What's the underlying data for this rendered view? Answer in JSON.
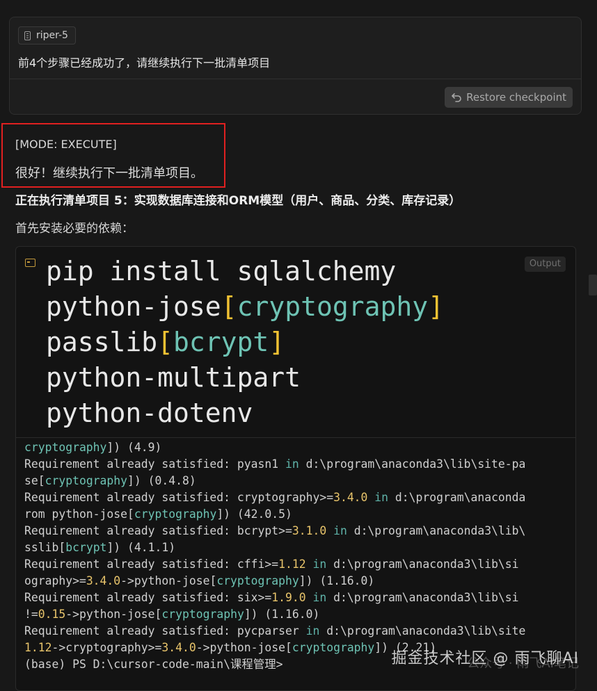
{
  "user_card": {
    "agent_name": "riper-5",
    "message": "前4个步骤已经成功了，请继续执行下一批清单项目",
    "restore_label": "Restore checkpoint"
  },
  "response": {
    "mode_line": "[MODE: EXECUTE]",
    "intro": "很好！继续执行下一批清单项目。",
    "heading": "正在执行清单项目 5：实现数据库连接和ORM模型（用户、商品、分类、库存记录）",
    "deps_label": "首先安装必要的依赖："
  },
  "terminal": {
    "output_badge": "Output",
    "command": {
      "l1": "pip install sqlalchemy",
      "l2_name": "python-jose",
      "l2_open": "[",
      "l2_extra": "cryptography",
      "l2_close": "]",
      "l3_name": "passlib",
      "l3_open": "[",
      "l3_extra": "bcrypt",
      "l3_close": "]",
      "l4": "python-multipart",
      "l5": "python-dotenv"
    },
    "output": {
      "l1_pkg": "cryptography",
      "l1_a": "]) (4.9)",
      "req": "Requirement already satisfied:",
      "in": "in",
      "l2_b": " pyasn1 ",
      "l2_c": " d:\\program\\anaconda3\\lib\\site-pa",
      "l3_a": "se[",
      "l3_pkg": "cryptography",
      "l3_b": "]) (0.4.8)",
      "l4_b": " cryptography>=",
      "l4_n": "3.4.0",
      "l4_c": " d:\\program\\anaconda",
      "l5_a": "rom python-jose[",
      "l5_pkg": "cryptography",
      "l5_b": "]) (42.0.5)",
      "l6_b": " bcrypt>=",
      "l6_n": "3.1.0",
      "l6_c": " d:\\program\\anaconda3\\lib\\",
      "l7_a": "sslib[",
      "l7_pkg": "bcrypt",
      "l7_b": "]) (4.1.1)",
      "l8_b": " cffi>=",
      "l8_n": "1.12",
      "l8_c": " d:\\program\\anaconda3\\lib\\si",
      "l9_a": "ography>=",
      "l9_n": "3.4.0",
      "l9_b": "->python-jose[",
      "l9_pkg": "cryptography",
      "l9_c": "]) (1.16.0)",
      "l10_b": " six>=",
      "l10_n": "1.9.0",
      "l10_c": " d:\\program\\anaconda3\\lib\\si",
      "l11_a": "!=",
      "l11_n": "0.15",
      "l11_b": "->python-jose[",
      "l11_pkg": "cryptography",
      "l11_c": "]) (1.16.0)",
      "l12_b": " pycparser ",
      "l12_c": " d:\\program\\anaconda3\\lib\\site",
      "l13_n1": "1.12",
      "l13_a": "->cryptography>=",
      "l13_n2": "3.4.0",
      "l13_b": "->python-jose[",
      "l13_pkg": "cryptography",
      "l13_c": "]) (2.21)",
      "prompt": "(base) PS D:\\cursor-code-main\\课程管理>"
    }
  },
  "watermark": {
    "main": "掘金技术社区 @ 雨飞聊AI",
    "sub": "公众号 · 雨飞AI笔记"
  }
}
